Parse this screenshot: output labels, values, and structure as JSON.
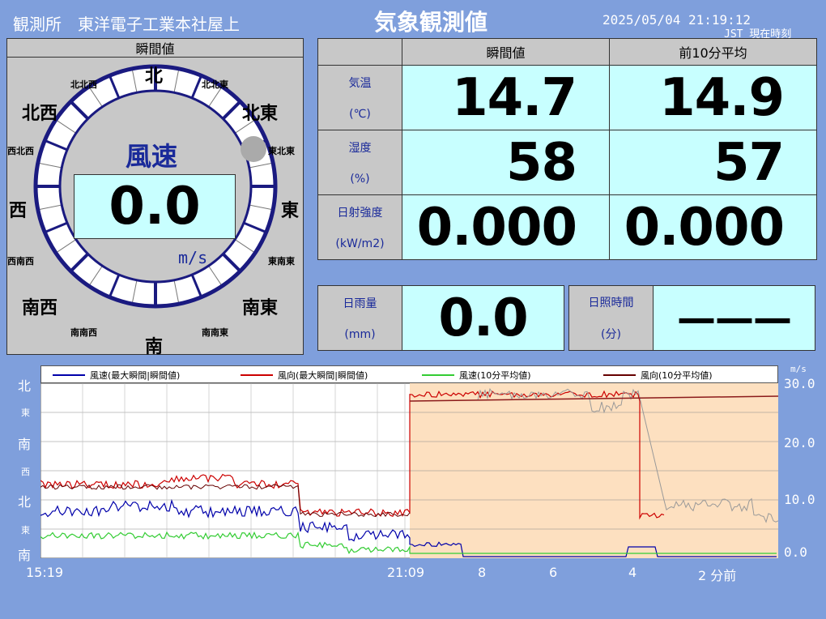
{
  "header": {
    "station": "観測所　東洋電子工業本社屋上",
    "title": "気象観測値",
    "datetime": "2025/05/04 21:19:12",
    "jst": "JST 現在時刻"
  },
  "wind_panel": {
    "header": "瞬間値",
    "label": "風速",
    "value": "0.0",
    "unit": "m/s",
    "directions": {
      "n": "北",
      "nnw": "北北西",
      "nne": "北北東",
      "nw": "北西",
      "ne": "北東",
      "wnw": "西北西",
      "ene": "東北東",
      "w": "西",
      "e": "東",
      "wsw": "西南西",
      "ese": "東南東",
      "sw": "南西",
      "se": "南東",
      "ssw": "南南西",
      "sse": "南南東",
      "s": "南"
    }
  },
  "table": {
    "col_instant": "瞬間値",
    "col_avg": "前10分平均",
    "rows": [
      {
        "name": "気温",
        "unit": "(℃)",
        "instant": "14.7",
        "avg": "14.9"
      },
      {
        "name": "湿度",
        "unit": "(%)",
        "instant": "58",
        "avg": "57"
      },
      {
        "name": "日射強度",
        "unit": "(kW/m2)",
        "instant": "0.000",
        "avg": "0.000"
      }
    ]
  },
  "rain": {
    "name": "日雨量",
    "unit": "(mm)",
    "value": "0.0"
  },
  "sunshine": {
    "name": "日照時間",
    "unit": "(分)",
    "value": "———"
  },
  "chart_data": {
    "type": "line",
    "legend": [
      {
        "name": "風速(最大瞬間|瞬間値)",
        "color": "#0000aa"
      },
      {
        "name": "風向(最大瞬間|瞬間値)",
        "color": "#cc0000"
      },
      {
        "name": "風速(10分平均値)",
        "color": "#33cc33"
      },
      {
        "name": "風向(10分平均値)",
        "color": "#660000"
      }
    ],
    "left_ticks": [
      "北",
      "東",
      "南",
      "西",
      "北",
      "東",
      "南"
    ],
    "right_unit": "m/s",
    "right_ticks": [
      "30.0",
      "20.0",
      "10.0",
      "0.0"
    ],
    "ylim": [
      0,
      30
    ],
    "x_labels": [
      "15:19",
      "21:09",
      "8",
      "6",
      "4",
      "2 分前"
    ],
    "colors": {
      "highlight": "#fde0c0",
      "avg_dir_recent": "#8b1a1a",
      "inst_dir_recent": "#999999"
    }
  }
}
